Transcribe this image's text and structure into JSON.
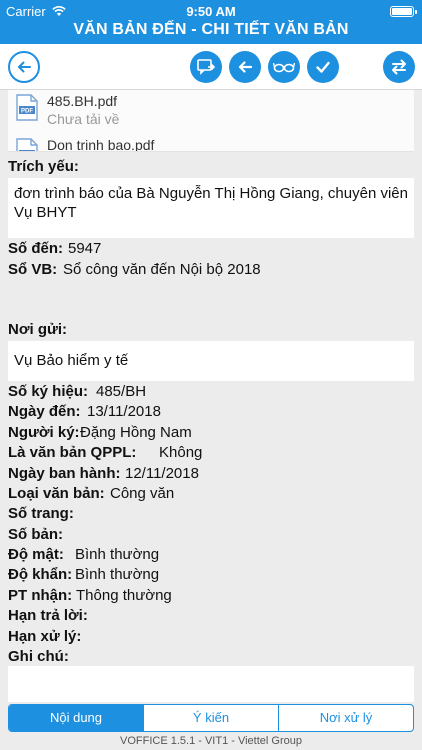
{
  "status_bar": {
    "carrier": "Carrier",
    "time": "9:50 AM"
  },
  "header": {
    "title": "VĂN BẢN ĐẾN - CHI TIẾT VĂN BẢN"
  },
  "toolbar": {
    "icons": [
      "back-circle-icon",
      "forward-message-icon",
      "arrow-left-icon",
      "glasses-icon",
      "checkmark-icon",
      "swap-icon"
    ],
    "accent_color": "#1e90e0"
  },
  "attachments": [
    {
      "name": "485.BH.pdf",
      "status": "Chưa tải về"
    },
    {
      "name": "Don trinh bao.pdf",
      "status": ""
    }
  ],
  "fields": {
    "trich_yeu_label": "Trích yếu:",
    "trich_yeu_value": "đơn trình báo của Bà Nguyễn Thị Hồng Giang, chuyên viên Vụ BHYT",
    "so_den_label": "Số đến:",
    "so_den_value": "5947",
    "so_vb_label": "Sổ VB:",
    "so_vb_value": "Sổ công văn đến Nội bộ 2018",
    "noi_gui_label": "Nơi gửi:",
    "noi_gui_value": "Vụ Bảo hiểm y tế",
    "so_ky_hieu_label": "Số ký hiệu:",
    "so_ky_hieu_value": "485/BH",
    "ngay_den_label": "Ngày đến:",
    "ngay_den_value": "13/11/2018",
    "nguoi_ky_label": "Người ký:",
    "nguoi_ky_value": "Đặng Hồng Nam",
    "qppl_label": "Là văn bản QPPL:",
    "qppl_value": "Không",
    "ngay_ban_hanh_label": "Ngày ban hành:",
    "ngay_ban_hanh_value": "12/11/2018",
    "loai_vb_label": "Loại văn bản:",
    "loai_vb_value": "Công văn",
    "so_trang_label": "Số trang:",
    "so_ban_label": "Số bản:",
    "do_mat_label": "Độ mật:",
    "do_mat_value": "Bình thường",
    "do_khan_label": "Độ khẩn:",
    "do_khan_value": "Bình thường",
    "pt_nhan_label": "PT nhận:",
    "pt_nhan_value": "Thông thường",
    "han_tra_loi_label": "Hạn trả lời:",
    "han_xu_ly_label": "Hạn xử lý:",
    "ghi_chu_label": "Ghi chú:"
  },
  "tabs": [
    {
      "label": "Nội dung",
      "active": true
    },
    {
      "label": "Ý kiến",
      "active": false
    },
    {
      "label": "Nơi xử lý",
      "active": false
    }
  ],
  "footer": {
    "text": "VOFFICE 1.5.1 - VIT1 - Viettel Group"
  }
}
